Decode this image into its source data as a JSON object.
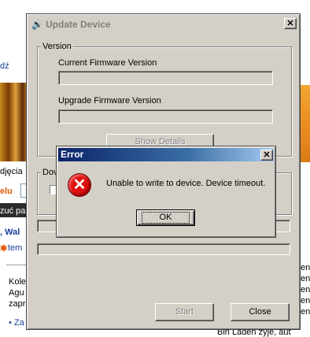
{
  "background_page": {
    "fragments": [
      "dź",
      "djęcia",
      "elu",
      "zuć pa",
      ", Wal",
      "tem",
      "Kole",
      "Agu",
      "zapr",
      "• Za",
      "en",
      "en",
      "en",
      "en",
      "en",
      "Bin Laden żyje, aut"
    ]
  },
  "update_window": {
    "title": "Update Device",
    "close_glyph": "✕",
    "version_group_label": "Version",
    "current_firmware_label": "Current Firmware Version",
    "current_firmware_value": "",
    "upgrade_firmware_label": "Upgrade Firmware Version",
    "upgrade_firmware_value": "",
    "show_details_label": "Show Details",
    "download_group_label": "Dov",
    "start_label": "Start",
    "close_label": "Close"
  },
  "error_dialog": {
    "title": "Error",
    "close_glyph": "✕",
    "message": "Unable to write to device.  Device timeout.",
    "ok_label": "OK",
    "icon": "error-x-icon"
  }
}
